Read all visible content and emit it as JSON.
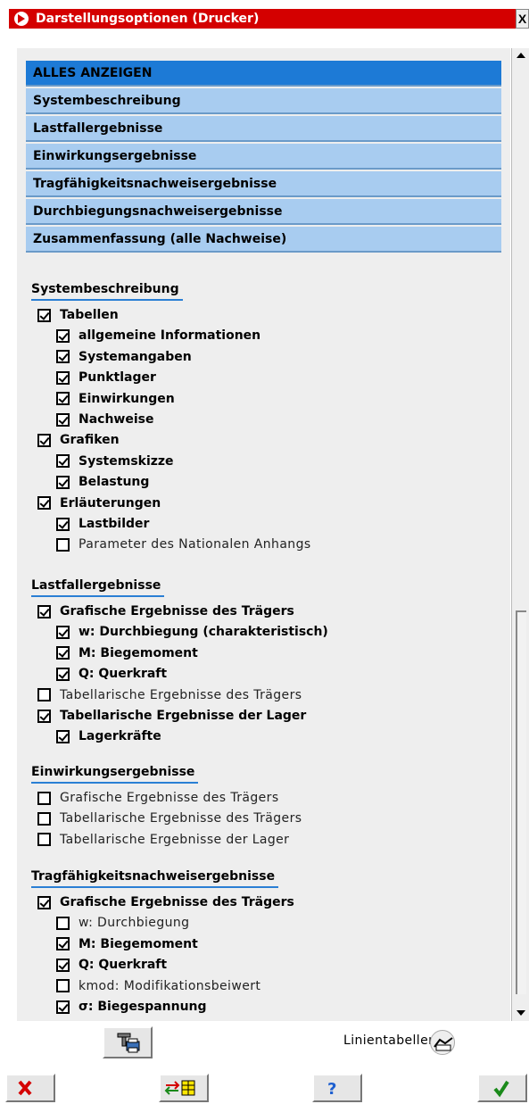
{
  "window": {
    "title": "Darstellungsoptionen (Drucker)",
    "close_label": "X"
  },
  "categories": [
    {
      "label": "ALLES ANZEIGEN",
      "active": true
    },
    {
      "label": "Systembeschreibung",
      "active": false
    },
    {
      "label": "Lastfallergebnisse",
      "active": false
    },
    {
      "label": "Einwirkungsergebnisse",
      "active": false
    },
    {
      "label": "Tragfähigkeitsnachweisergebnisse",
      "active": false
    },
    {
      "label": "Durchbiegungsnachweisergebnisse",
      "active": false
    },
    {
      "label": "Zusammenfassung (alle Nachweise)",
      "active": false
    }
  ],
  "sections": [
    {
      "title": "Systembeschreibung",
      "items": [
        {
          "label": "Tabellen",
          "checked": true,
          "level": 0
        },
        {
          "label": "allgemeine Informationen",
          "checked": true,
          "level": 1
        },
        {
          "label": "Systemangaben",
          "checked": true,
          "level": 1
        },
        {
          "label": "Punktlager",
          "checked": true,
          "level": 1
        },
        {
          "label": "Einwirkungen",
          "checked": true,
          "level": 1
        },
        {
          "label": "Nachweise",
          "checked": true,
          "level": 1
        },
        {
          "label": "Grafiken",
          "checked": true,
          "level": 0
        },
        {
          "label": "Systemskizze",
          "checked": true,
          "level": 1
        },
        {
          "label": "Belastung",
          "checked": true,
          "level": 1
        },
        {
          "label": "Erläuterungen",
          "checked": true,
          "level": 0
        },
        {
          "label": "Lastbilder",
          "checked": true,
          "level": 1
        },
        {
          "label": "Parameter des Nationalen Anhangs",
          "checked": false,
          "level": 1
        }
      ]
    },
    {
      "title": "Lastfallergebnisse",
      "items": [
        {
          "label": "Grafische Ergebnisse des Trägers",
          "checked": true,
          "level": 0
        },
        {
          "label": "w: Durchbiegung (charakteristisch)",
          "checked": true,
          "level": 1
        },
        {
          "label": "M: Biegemoment",
          "checked": true,
          "level": 1
        },
        {
          "label": "Q: Querkraft",
          "checked": true,
          "level": 1
        },
        {
          "label": "Tabellarische Ergebnisse des Trägers",
          "checked": false,
          "level": 0
        },
        {
          "label": "Tabellarische Ergebnisse der Lager",
          "checked": true,
          "level": 0
        },
        {
          "label": "Lagerkräfte",
          "checked": true,
          "level": 1
        }
      ]
    },
    {
      "title": "Einwirkungsergebnisse",
      "items": [
        {
          "label": "Grafische Ergebnisse des Trägers",
          "checked": false,
          "level": 0
        },
        {
          "label": "Tabellarische Ergebnisse des Trägers",
          "checked": false,
          "level": 0
        },
        {
          "label": "Tabellarische Ergebnisse der Lager",
          "checked": false,
          "level": 0
        }
      ]
    },
    {
      "title": "Tragfähigkeitsnachweisergebnisse",
      "items": [
        {
          "label": "Grafische Ergebnisse des Trägers",
          "checked": true,
          "level": 0
        },
        {
          "label": "w: Durchbiegung",
          "checked": false,
          "level": 1
        },
        {
          "label": "M: Biegemoment",
          "checked": true,
          "level": 1
        },
        {
          "label": "Q: Querkraft",
          "checked": true,
          "level": 1
        },
        {
          "label": "kmod: Modifikationsbeiwert",
          "checked": false,
          "level": 1
        },
        {
          "label": "σ: Biegespannung",
          "checked": true,
          "level": 1
        }
      ]
    }
  ],
  "footer": {
    "linientabellen_label": "Linientabellen"
  },
  "colors": {
    "titlebar": "#d40000",
    "category": "#a8ccf0",
    "category_active": "#1d7ad6",
    "underline": "#2a7fd4",
    "panel": "#eeeeee"
  },
  "icons": [
    "arrow-right-icon",
    "print-settings-icon",
    "line-tables-icon",
    "cancel-icon",
    "swap-table-icon",
    "help-icon",
    "ok-icon"
  ]
}
